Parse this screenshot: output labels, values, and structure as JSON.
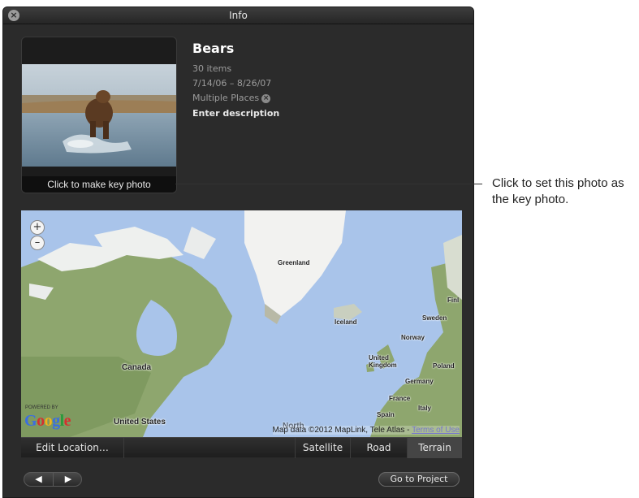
{
  "window": {
    "title": "Info",
    "close_icon": "close-icon"
  },
  "photo": {
    "caption": "Click to make key photo"
  },
  "album": {
    "name": "Bears",
    "items": "30 items",
    "dates": "7/14/06 – 8/26/07",
    "places": "Multiple Places",
    "description_placeholder": "Enter description"
  },
  "map": {
    "zoom_in": "+",
    "zoom_out": "–",
    "labels": {
      "greenland": "Greenland",
      "iceland": "Iceland",
      "canada": "Canada",
      "united_states": "United States",
      "united_kingdom": "United Kingdom",
      "norway": "Norway",
      "sweden": "Sweden",
      "finland": "Finl",
      "poland": "Poland",
      "germany": "Germany",
      "france": "France",
      "italy": "Italy",
      "spain": "Spain",
      "north_atlantic": "North"
    },
    "powered_by": "POWERED BY",
    "logo": "Google",
    "attribution": "Map data ©2012 MapLink, Tele Atlas - ",
    "terms": "Terms of Use",
    "colors": {
      "water": "#a9c4ea",
      "land": "#8ea66e",
      "ice": "#f2f2f0"
    }
  },
  "toolbar": {
    "edit_location": "Edit Location…",
    "satellite": "Satellite",
    "road": "Road",
    "terrain": "Terrain",
    "active": "Terrain"
  },
  "footer": {
    "prev_icon": "arrow-left-icon",
    "next_icon": "arrow-right-icon",
    "go_to_project": "Go to Project"
  },
  "callout": {
    "text": "Click to set this photo as the key photo."
  }
}
